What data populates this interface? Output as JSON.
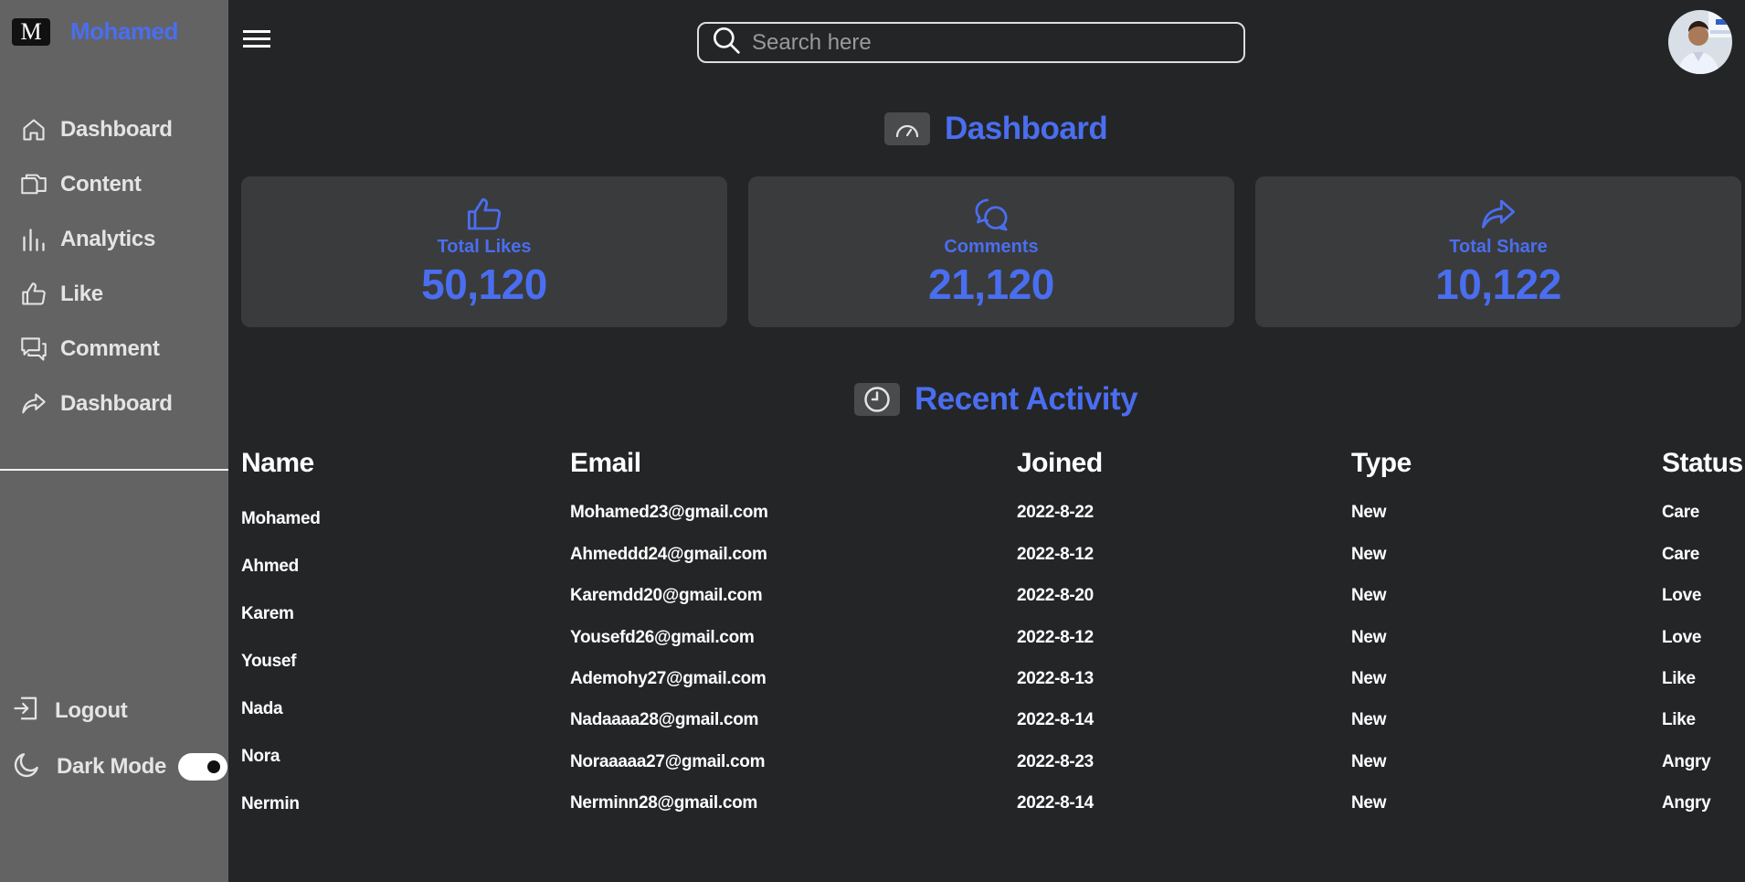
{
  "sidebar": {
    "logo_letter": "M",
    "brand_name": "Mohamed",
    "items": [
      {
        "label": "Dashboard",
        "icon": "home-icon"
      },
      {
        "label": "Content",
        "icon": "files-icon"
      },
      {
        "label": "Analytics",
        "icon": "bar-chart-icon"
      },
      {
        "label": "Like",
        "icon": "thumbs-up-icon"
      },
      {
        "label": "Comment",
        "icon": "comments-icon"
      },
      {
        "label": "Dashboard",
        "icon": "share-icon"
      }
    ],
    "logout_label": "Logout",
    "dark_mode_label": "Dark Mode",
    "dark_mode_on": true
  },
  "search": {
    "placeholder": "Search here"
  },
  "dashboard_title": "Dashboard",
  "cards": [
    {
      "label": "Total Likes",
      "value": "50,120",
      "icon": "thumbs-up-icon"
    },
    {
      "label": "Comments",
      "value": "21,120",
      "icon": "comments-icon"
    },
    {
      "label": "Total Share",
      "value": "10,122",
      "icon": "share-icon"
    }
  ],
  "activity_title": "Recent Activity",
  "table": {
    "headers": [
      "Name",
      "Email",
      "Joined",
      "Type",
      "Status"
    ],
    "names": [
      "Mohamed",
      "Ahmed",
      "Karem",
      "Yousef",
      "Nada",
      "Nora",
      "Nermin"
    ],
    "rows": [
      [
        "Mohamed23@gmail.com",
        "2022-8-22",
        "New",
        "Care"
      ],
      [
        "Ahmeddd24@gmail.com",
        "2022-8-12",
        "New",
        "Care"
      ],
      [
        "Karemdd20@gmail.com",
        "2022-8-20",
        "New",
        "Love"
      ],
      [
        "Yousefd26@gmail.com",
        "2022-8-12",
        "New",
        "Love"
      ],
      [
        "Ademohy27@gmail.com",
        "2022-8-13",
        "New",
        "Like"
      ],
      [
        "Nadaaaa28@gmail.com",
        "2022-8-14",
        "New",
        "Like"
      ],
      [
        "Noraaaaa27@gmail.com",
        "2022-8-23",
        "New",
        "Angry"
      ],
      [
        "Nerminn28@gmail.com",
        "2022-8-14",
        "New",
        "Angry"
      ]
    ]
  },
  "colors": {
    "accent": "#4a6ef0",
    "sidebar": "#636363",
    "background": "#242526",
    "card": "#3a3b3c"
  }
}
